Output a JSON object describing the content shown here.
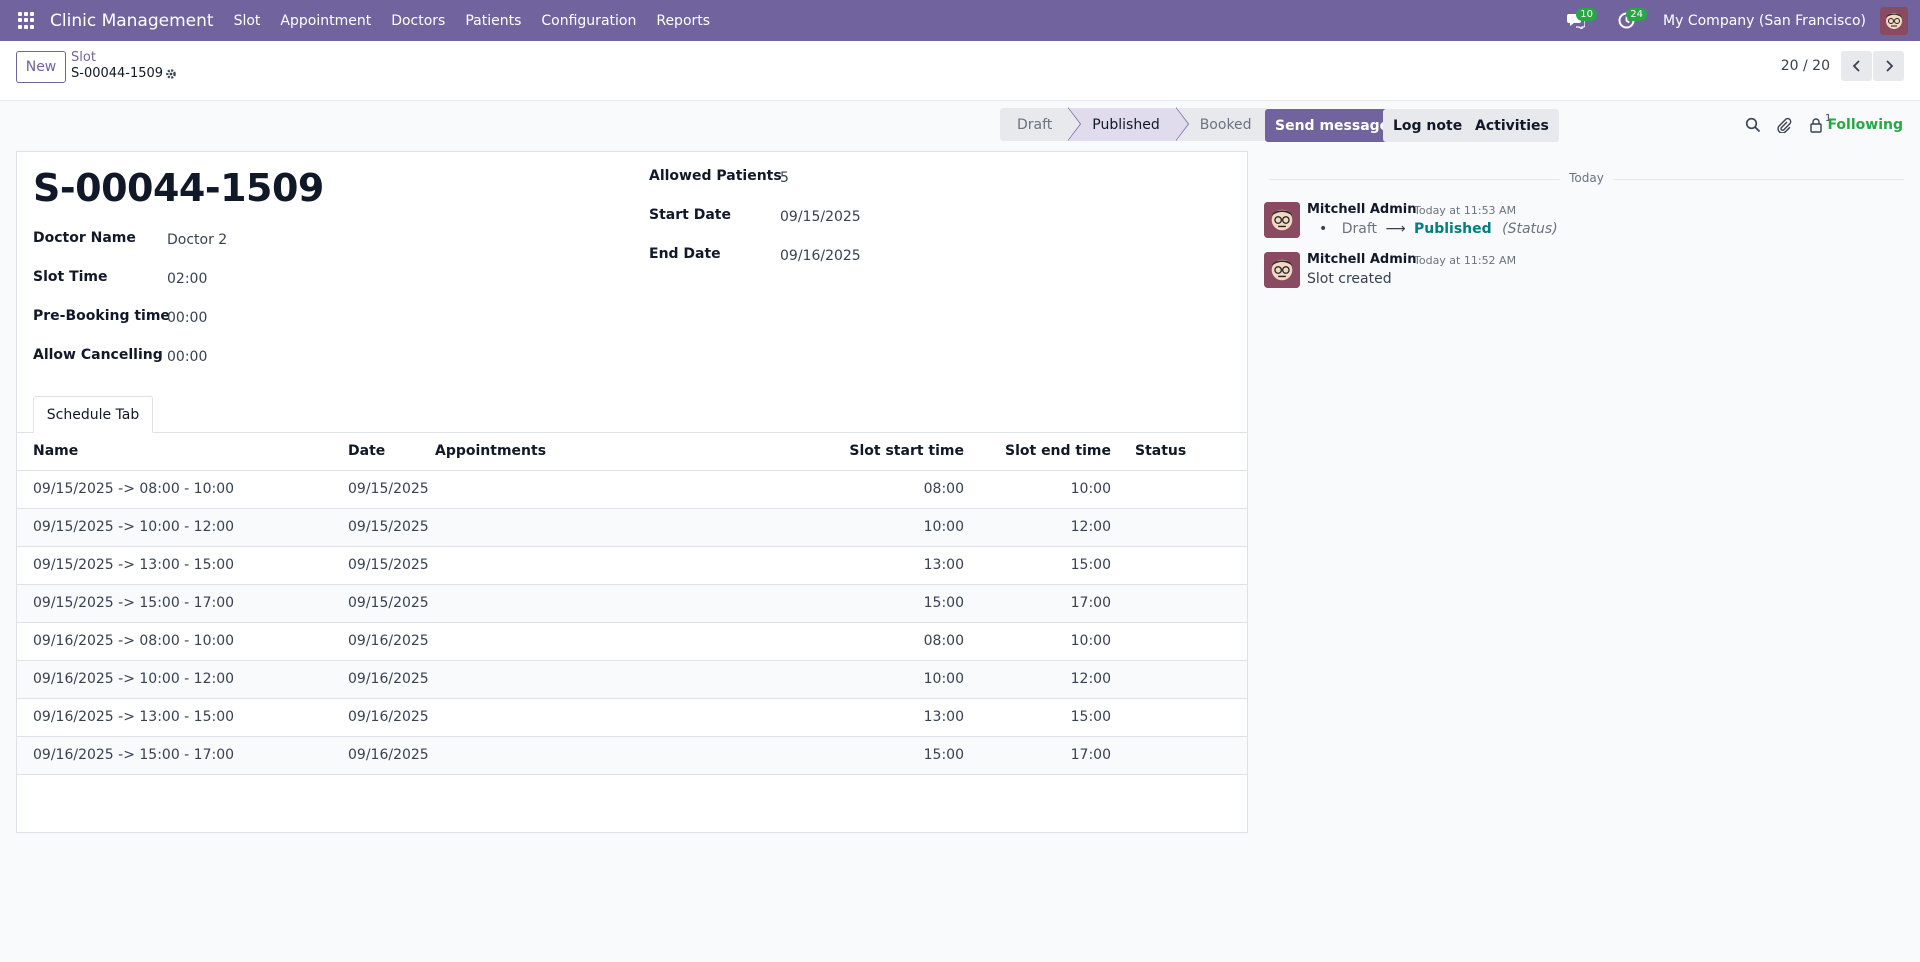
{
  "navbar": {
    "brand": "Clinic Management",
    "menu": [
      "Slot",
      "Appointment",
      "Doctors",
      "Patients",
      "Configuration",
      "Reports"
    ],
    "messages_count": "10",
    "activities_count": "24",
    "company": "My Company (San Francisco)"
  },
  "control": {
    "new_label": "New",
    "breadcrumb_parent": "Slot",
    "breadcrumb_current": "S-00044-1509",
    "pager": "20 / 20"
  },
  "statusbar": {
    "stages": [
      "Draft",
      "Published",
      "Booked"
    ],
    "active": "Published"
  },
  "form": {
    "title": "S-00044-1509",
    "doctor_name_label": "Doctor Name",
    "doctor_name": "Doctor 2",
    "slot_time_label": "Slot Time",
    "slot_time": "02:00",
    "prebooking_label": "Pre-Booking time",
    "prebooking": "00:00",
    "allow_cancel_label": "Allow Cancelling",
    "allow_cancel": "00:00",
    "allowed_patients_label": "Allowed Patients",
    "allowed_patients": "5",
    "start_date_label": "Start Date",
    "start_date": "09/15/2025",
    "end_date_label": "End Date",
    "end_date": "09/16/2025",
    "tab_label": "Schedule Tab"
  },
  "table": {
    "headers": {
      "name": "Name",
      "date": "Date",
      "appointments": "Appointments",
      "start": "Slot start time",
      "end": "Slot end time",
      "status": "Status"
    },
    "rows": [
      {
        "name": "09/15/2025 -> 08:00 - 10:00",
        "date": "09/15/2025",
        "start": "08:00",
        "end": "10:00"
      },
      {
        "name": "09/15/2025 -> 10:00 - 12:00",
        "date": "09/15/2025",
        "start": "10:00",
        "end": "12:00"
      },
      {
        "name": "09/15/2025 -> 13:00 - 15:00",
        "date": "09/15/2025",
        "start": "13:00",
        "end": "15:00"
      },
      {
        "name": "09/15/2025 -> 15:00 - 17:00",
        "date": "09/15/2025",
        "start": "15:00",
        "end": "17:00"
      },
      {
        "name": "09/16/2025 -> 08:00 - 10:00",
        "date": "09/16/2025",
        "start": "08:00",
        "end": "10:00"
      },
      {
        "name": "09/16/2025 -> 10:00 - 12:00",
        "date": "09/16/2025",
        "start": "10:00",
        "end": "12:00"
      },
      {
        "name": "09/16/2025 -> 13:00 - 15:00",
        "date": "09/16/2025",
        "start": "13:00",
        "end": "15:00"
      },
      {
        "name": "09/16/2025 -> 15:00 - 17:00",
        "date": "09/16/2025",
        "start": "15:00",
        "end": "17:00"
      }
    ]
  },
  "chatter": {
    "send_message": "Send message",
    "log_note": "Log note",
    "activities": "Activities",
    "follower_count": "1",
    "following": "Following",
    "date_separator": "Today",
    "messages": [
      {
        "author": "Mitchell Admin",
        "time": "Today at 11:53 AM",
        "old": "Draft",
        "new": "Published",
        "field": "(Status)"
      },
      {
        "author": "Mitchell Admin",
        "time": "Today at 11:52 AM",
        "body": "Slot created"
      }
    ]
  },
  "colors": {
    "brand": "#71639e",
    "badge": "#28a745",
    "following": "#28a745",
    "tracking_new": "#017e84"
  },
  "icons": [
    "apps-icon",
    "chat-icon",
    "clock-icon",
    "avatar",
    "gear-icon",
    "chevron-left-icon",
    "chevron-right-icon",
    "search-icon",
    "paperclip-icon",
    "follower-icon"
  ]
}
